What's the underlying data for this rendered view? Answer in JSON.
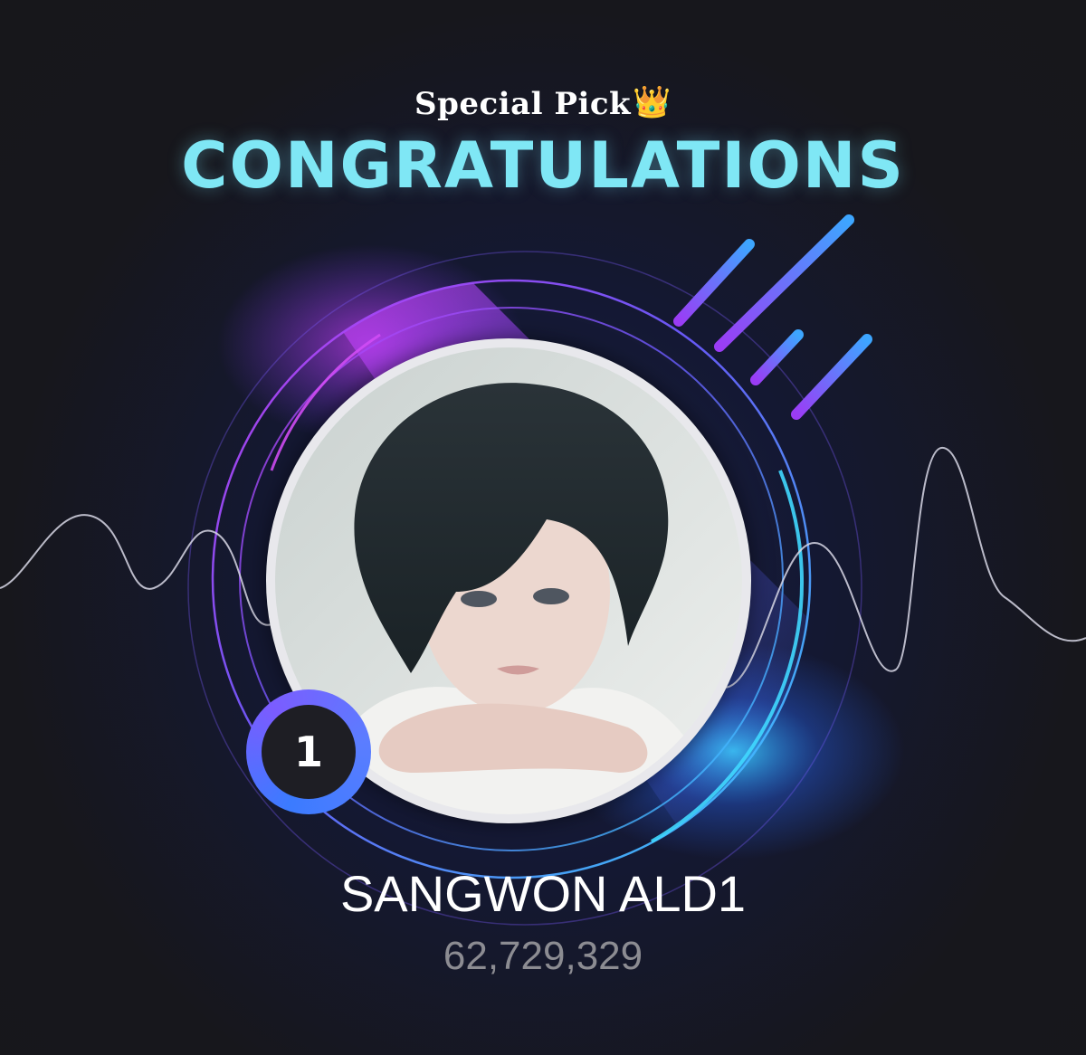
{
  "header": {
    "subtitle": "Special Pick",
    "subtitle_icon": "crown-icon",
    "title": "CONGRATULATIONS"
  },
  "winner": {
    "rank": "1",
    "name": "SANGWON ALD1",
    "votes": "62,729,329"
  },
  "colors": {
    "title": "#7fe7f5",
    "background": "#17171c",
    "accent_purple": "#b43cf0",
    "accent_blue": "#3da6ff",
    "accent_cyan": "#40d8ff",
    "vote_text": "#8c8c92"
  }
}
